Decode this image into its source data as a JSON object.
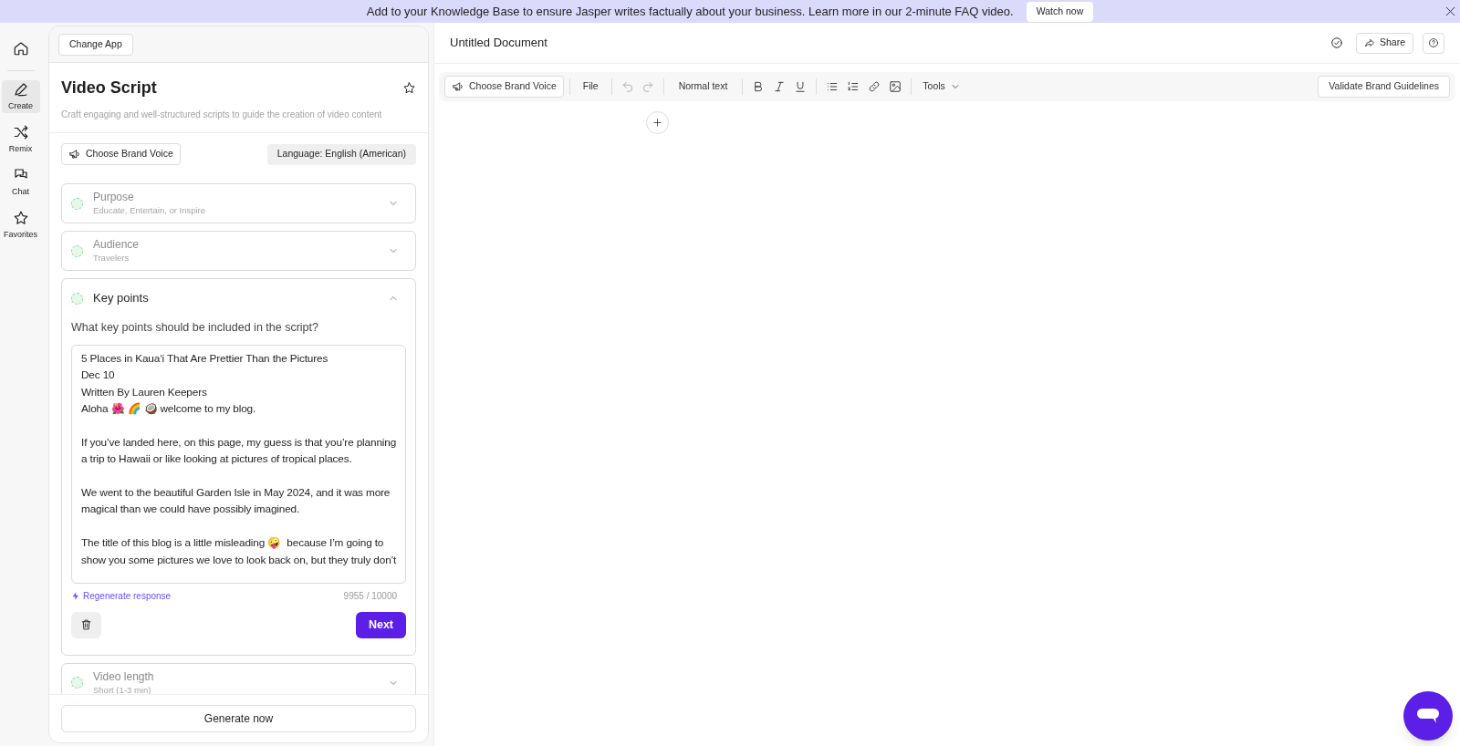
{
  "banner": {
    "message": "Add to your Knowledge Base to ensure Jasper writes factually about your business. Learn more in our 2-minute FAQ video.",
    "button": "Watch now"
  },
  "nav": [
    {
      "kind": "home",
      "selected": false
    },
    {
      "kind": "create",
      "label": "Create",
      "selected": true
    },
    {
      "kind": "remix",
      "label": "Remix",
      "selected": false
    },
    {
      "kind": "chat",
      "label": "Chat",
      "selected": false
    },
    {
      "kind": "favorites",
      "label": "Favorites",
      "selected": false
    }
  ],
  "panel": {
    "change_app": "Change App",
    "title": "Video Script",
    "description": "Craft engaging and well-structured scripts to guide the creation of video content",
    "brand_voice": "Choose Brand Voice",
    "language": "Language: English (American)",
    "sections": [
      {
        "title": "Purpose",
        "value": "Educate, Entertain, or Inspire",
        "expanded": false
      },
      {
        "title": "Audience",
        "value": "Travelers",
        "expanded": false
      },
      {
        "title": "Key points",
        "expanded": true,
        "question": "What key points should be included in the script?",
        "answer": "5 Places in Kaua‘i That Are Prettier Than the Pictures\nDec 10\nWritten By Lauren Keepers\nAloha 🌺 🌈 🥥 welcome to my blog.\n\nIf you’ve landed here, on this page, my guess is that you’re planning a trip to Hawaii or like looking at pictures of tropical places.\n\nWe went to the beautiful Garden Isle in May 2024, and it was more magical than we could have possibly imagined.\n\nThe title of this blog is a little misleading 🤪  because I’m going to show you some pictures we love to look back on, but they truly don’t",
        "regenerate": "Regenerate response",
        "counter": "9955 / 10000",
        "next": "Next"
      },
      {
        "title": "Video length",
        "value": "Short (1-3 min)",
        "expanded": false
      }
    ],
    "generate": "Generate now"
  },
  "document": {
    "title": "Untitled Document",
    "share": "Share",
    "toolbar": {
      "brand_voice": "Choose Brand Voice",
      "file": "File",
      "style": "Normal text",
      "tools": "Tools",
      "validate": "Validate Brand Guidelines"
    }
  }
}
